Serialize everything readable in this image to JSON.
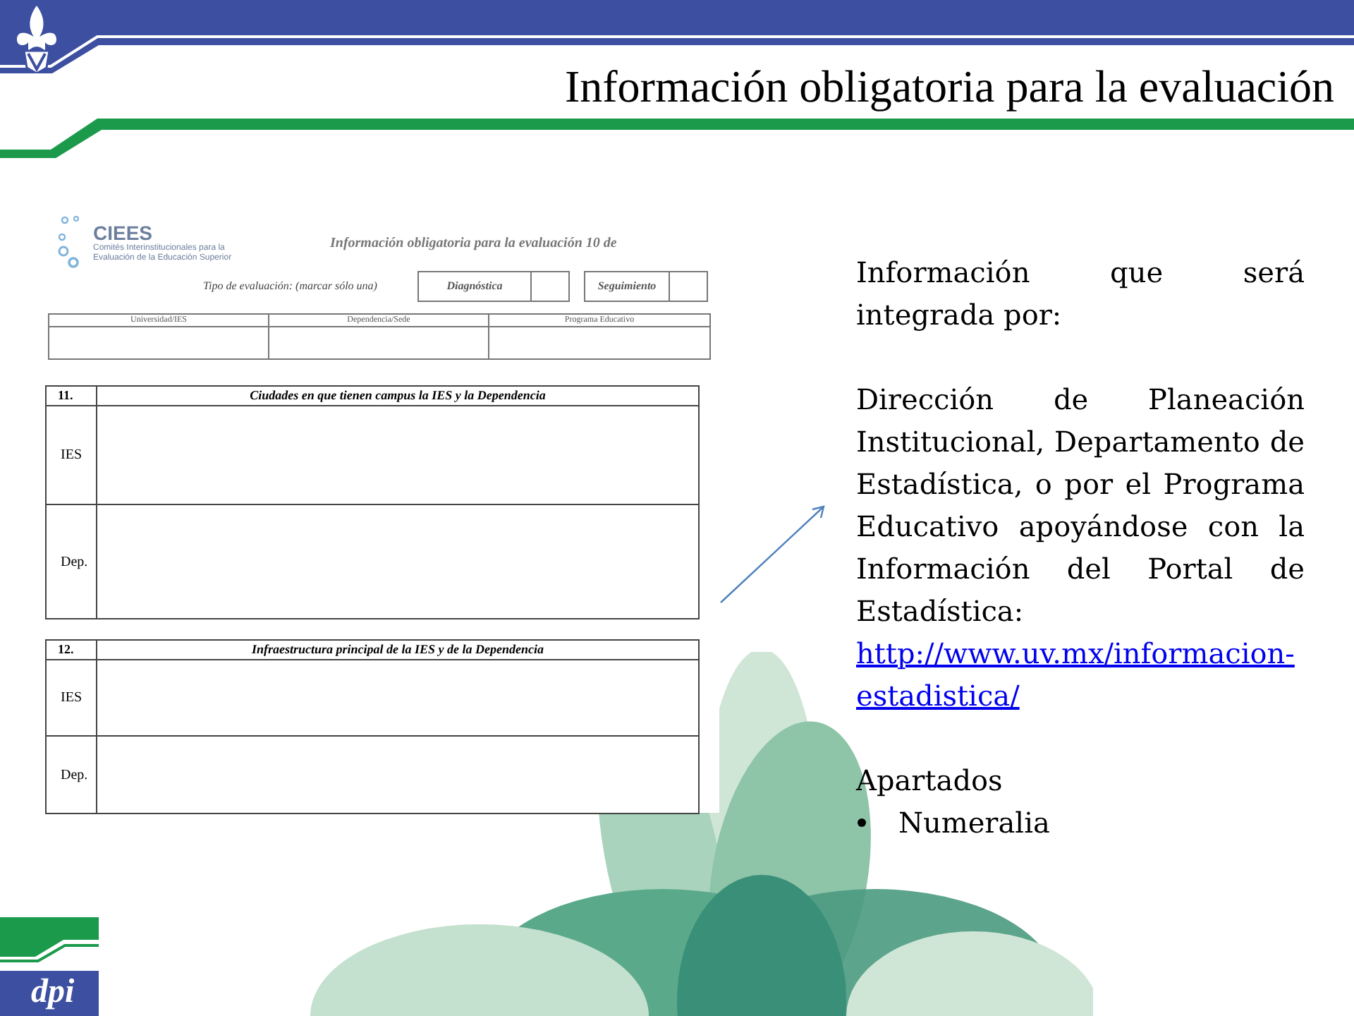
{
  "title": "Información obligatoria para la evaluación",
  "document": {
    "logo": {
      "acronym": "CIEES",
      "subtitle": [
        "Comités Interinstitucionales para la",
        "Evaluación de la Educación Superior"
      ]
    },
    "heading": "Información obligatoria para la evaluación 10 de",
    "evaluation_type": {
      "label": "Tipo de evaluación: (marcar sólo una)",
      "options": [
        "Diagnóstica",
        "Seguimiento"
      ]
    },
    "columns": [
      "Universidad/IES",
      "Dependencia/Sede",
      "Programa  Educativo"
    ],
    "sections": [
      {
        "number": "11.",
        "title": "Ciudades en que tienen campus la IES y la Dependencia",
        "rows": [
          "IES",
          "Dep."
        ]
      },
      {
        "number": "12.",
        "title": "Infraestructura  principal de la IES y de la Dependencia",
        "rows": [
          "IES",
          "Dep."
        ]
      }
    ]
  },
  "text": {
    "paragraphs": [
      "Información que será integrada por:",
      "Dirección de Planeación Institucional, Departamento de Estadística, o por el Programa Educativo apoyándose con la Información del Portal de Estadística:"
    ],
    "link": "http://www.uv.mx/informacion-estadistica/",
    "section_label": "Apartados",
    "bullets": [
      "Numeralia"
    ]
  },
  "footer_logo": "dpi"
}
